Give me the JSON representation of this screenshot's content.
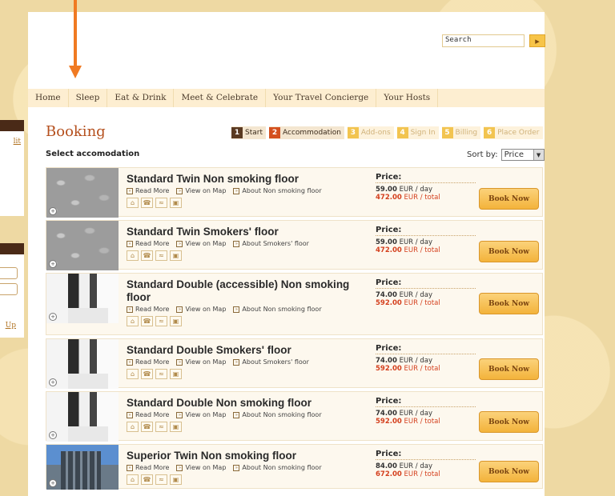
{
  "sidebar": {
    "edit_label": "lit",
    "signup_label": "Up"
  },
  "search": {
    "value": "Search",
    "button_icon": "arrow-right-icon"
  },
  "nav": [
    "Home",
    "Sleep",
    "Eat & Drink",
    "Meet & Celebrate",
    "Your Travel Concierge",
    "Your Hosts"
  ],
  "booking": {
    "title": "Booking",
    "steps": [
      {
        "num": "1",
        "label": "Start"
      },
      {
        "num": "2",
        "label": "Accommodation"
      },
      {
        "num": "3",
        "label": "Add-ons"
      },
      {
        "num": "4",
        "label": "Sign In"
      },
      {
        "num": "5",
        "label": "Billing"
      },
      {
        "num": "6",
        "label": "Place Order"
      }
    ],
    "select_label": "Select accomodation",
    "sort_label": "Sort by:",
    "sort_value": "Price"
  },
  "rooms": [
    {
      "name": "Standard Twin Non smoking floor",
      "link1": "Read More",
      "link2": "View on Map",
      "link3": "About Non smoking floor",
      "price_label": "Price:",
      "day_price": "59.00",
      "day_suffix": "EUR / day",
      "total_price": "472.00",
      "total_suffix": "EUR / total",
      "book": "Book Now"
    },
    {
      "name": "Standard Twin Smokers' floor",
      "link1": "Read More",
      "link2": "View on Map",
      "link3": "About Smokers' floor",
      "price_label": "Price:",
      "day_price": "59.00",
      "day_suffix": "EUR / day",
      "total_price": "472.00",
      "total_suffix": "EUR / total",
      "book": "Book Now"
    },
    {
      "name": "Standard Double (accessible) Non smoking floor",
      "link1": "Read More",
      "link2": "View on Map",
      "link3": "About Non smoking floor",
      "price_label": "Price:",
      "day_price": "74.00",
      "day_suffix": "EUR / day",
      "total_price": "592.00",
      "total_suffix": "EUR / total",
      "book": "Book Now"
    },
    {
      "name": "Standard Double Smokers' floor",
      "link1": "Read More",
      "link2": "View on Map",
      "link3": "About Smokers' floor",
      "price_label": "Price:",
      "day_price": "74.00",
      "day_suffix": "EUR / day",
      "total_price": "592.00",
      "total_suffix": "EUR / total",
      "book": "Book Now"
    },
    {
      "name": "Standard Double Non smoking floor",
      "link1": "Read More",
      "link2": "View on Map",
      "link3": "About Non smoking floor",
      "price_label": "Price:",
      "day_price": "74.00",
      "day_suffix": "EUR / day",
      "total_price": "592.00",
      "total_suffix": "EUR / total",
      "book": "Book Now"
    },
    {
      "name": "Superior Twin Non smoking floor",
      "link1": "Read More",
      "link2": "View on Map",
      "link3": "About Non smoking floor",
      "price_label": "Price:",
      "day_price": "84.00",
      "day_suffix": "EUR / day",
      "total_price": "672.00",
      "total_suffix": "EUR / total",
      "book": "Book Now"
    }
  ],
  "colors": {
    "accent": "#b5501e",
    "button": "#f3b33b",
    "price_total": "#d4401e",
    "nav_bg": "#fdeed1",
    "page_bg": "#eed9a3"
  }
}
